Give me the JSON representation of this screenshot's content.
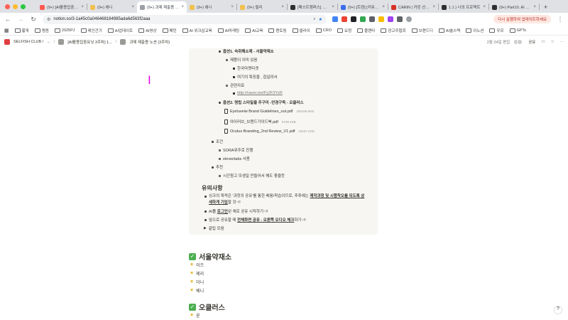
{
  "browser": {
    "tabs": [
      {
        "label": "(9+) [AI활용집중유…",
        "color": "#ff5a4f"
      },
      {
        "label": "(9+) 헤니",
        "color": "#f2c14e"
      },
      {
        "label": "(9+) 과제 제출용 노…",
        "color": "#9aa0a6",
        "active": true
      },
      {
        "label": "(9+) 헤니",
        "color": "#f2c14e"
      },
      {
        "label": "(9+) 릴리",
        "color": "#f2c14e"
      },
      {
        "label": "[패스트캠퍼스] 하이…",
        "color": "#2f2f2f"
      },
      {
        "label": "(9+) [트렌] [커뮤…",
        "color": "#3c6df0"
      },
      {
        "label": "CARIN | 카린 선글…",
        "color": "#d93025"
      },
      {
        "label": "1.1 ) 나의 프로젝트",
        "color": "#2f2f2f"
      },
      {
        "label": "(9+) Part10. AI 업…",
        "color": "#2f2f2f"
      }
    ],
    "new_tab": "+",
    "url": "notion.so/3-1a45c0a046468184985ada6d563f2aaa",
    "update_button": "다시 실행하여 업데이트하세요",
    "bookmarks": [
      "짧게",
      "랭원",
      "2025PJ",
      "레인건기",
      "AI업데이트",
      "AI영상",
      "패턴",
      "AI 위크샵교육",
      "AI마케팅",
      "AI교육",
      "랜토링",
      "클라이",
      "CRO",
      "요청",
      "플랜타",
      "광고주협회",
      "브랜드디",
      "AI솔스택",
      "이노션",
      "우모",
      "GPTs"
    ],
    "colors": {
      "tabbar": "#dfe1e5",
      "accent_update": "#b3261e"
    }
  },
  "notion": {
    "workspace": "SELFISH CLUB /",
    "breadcrumb_ellipsis": "...",
    "breadcrumb_1": "[AI활용집중유닛 3주차] 1...",
    "breadcrumb_2": "과제 제출용 노션 (3주차)",
    "edited": "2월 24일 편집",
    "share": "공유"
  },
  "page": {
    "option1": "옵션1. 숙취해소제 - 서울약재소",
    "option1_a": "제품이 이미 있음",
    "option1_a1": "한국마켓타겟",
    "option1_a2": "여기의 특징을 , 잡살려서",
    "option1_b": "관련자료",
    "option1_b1": "http://naver.me/Fy2F3YzR",
    "option2": "옵션2. 명립 스타일을 추구미 -안경구독 - 오클러스",
    "files": [
      {
        "name": "Eyeluveiw Brand Guidelines_out.pdf",
        "size": "188159.6KB"
      },
      {
        "name": "아이러브_브랜드가이드북.pdf",
        "size": "9739.2KB"
      },
      {
        "name": "Oculus Branding_2nd Review_V1.pdf",
        "size": "43167.2KB"
      }
    ],
    "cond_title": "조건",
    "cond_1": "SORA위주로 진행",
    "cond_2": "elevenlabs 사용",
    "rec_title": "추천",
    "rec_1": "시간참고 모생일 만들어서 해도 좋을듯",
    "notes_heading": "유의사항",
    "note_1_a": "싱크의 목적은 '과정의 공유'를 통한 배움/학습이므로, 추후에는 ",
    "note_1_b": "제작과정 및 시행착오를 되도록 상",
    "note_1_c": "세하게 기입",
    "note_1_d": "할 것~!!",
    "note_2_a": "AI툴 ",
    "note_2_b": "로그인",
    "note_2_c": "된 채로 공유 시작하기~!!",
    "note_3_a": "앞으로 공유할 때 ",
    "note_3_b": "전체화면 공유 - 오른쪽 오디오 체크",
    "note_3_c": "하기~!!",
    "toggle": "끝팁 모음",
    "section1_title": "서울약재소",
    "section1_items": [
      "이즈",
      "제리",
      "더니",
      "베니"
    ],
    "section2_title": "오클러스",
    "section2_items": [
      "윤"
    ],
    "help": "?"
  }
}
